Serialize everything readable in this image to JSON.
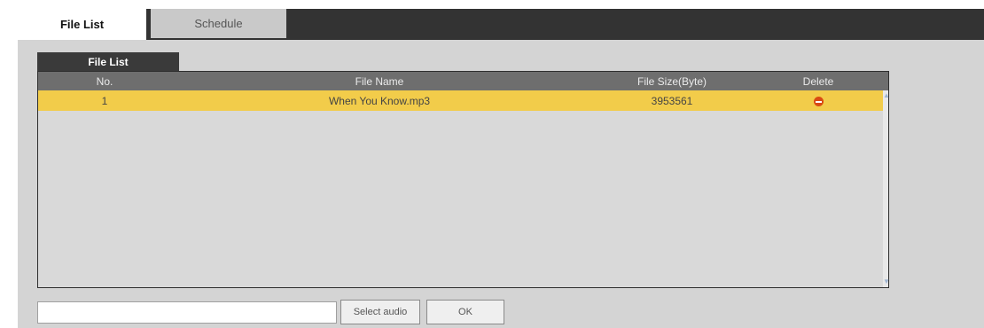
{
  "tabs": {
    "file_list": "File List",
    "schedule": "Schedule"
  },
  "panel": {
    "title": "File List"
  },
  "table": {
    "headers": {
      "no": "No.",
      "file_name": "File Name",
      "file_size": "File Size(Byte)",
      "delete": "Delete"
    },
    "rows": [
      {
        "no": "1",
        "file_name": "When You Know.mp3",
        "file_size": "3953561"
      }
    ]
  },
  "footer": {
    "path_value": "",
    "select_label": "Select audio",
    "ok_label": "OK"
  },
  "colors": {
    "selected_row": "#f2cc4a",
    "header_bg": "#6e6e6e",
    "delete_icon": "#d94a13"
  }
}
